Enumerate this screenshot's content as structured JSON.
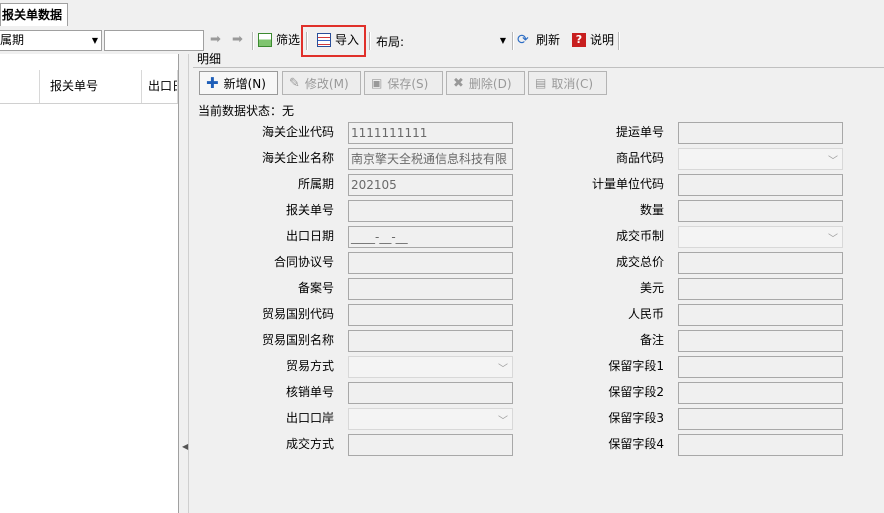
{
  "tab": {
    "title": "报关单数据"
  },
  "toolbar": {
    "period_combo": "属期",
    "search_value": "",
    "filter_label": "筛选",
    "import_label": "导入",
    "layout_label": "布局:",
    "layout_value": "",
    "refresh_label": "刷新",
    "help_label": "说明",
    "highlight_color": "#e0302a"
  },
  "grid": {
    "columns": [
      "报关单号",
      "出口日"
    ]
  },
  "detail": {
    "group_title": "明细",
    "buttons": {
      "add": "新增(N)",
      "edit": "修改(M)",
      "save": "保存(S)",
      "delete": "删除(D)",
      "cancel": "取消(C)"
    },
    "status_text": "当前数据状态：无",
    "left_fields": [
      {
        "label": "海关企业代码",
        "value": "1111111111"
      },
      {
        "label": "海关企业名称",
        "value": "南京擎天全税通信息科技有限"
      },
      {
        "label": "所属期",
        "value": "202105"
      },
      {
        "label": "报关单号",
        "value": ""
      },
      {
        "label": "出口日期",
        "value": "____-__-__"
      },
      {
        "label": "合同协议号",
        "value": ""
      },
      {
        "label": "备案号",
        "value": ""
      },
      {
        "label": "贸易国别代码",
        "value": ""
      },
      {
        "label": "贸易国别名称",
        "value": ""
      },
      {
        "label": "贸易方式",
        "value": ""
      },
      {
        "label": "核销单号",
        "value": ""
      },
      {
        "label": "出口口岸",
        "value": ""
      },
      {
        "label": "成交方式",
        "value": ""
      }
    ],
    "right_fields": [
      {
        "label": "提运单号",
        "value": ""
      },
      {
        "label": "商品代码",
        "value": ""
      },
      {
        "label": "计量单位代码",
        "value": ""
      },
      {
        "label": "数量",
        "value": ""
      },
      {
        "label": "成交币制",
        "value": ""
      },
      {
        "label": "成交总价",
        "value": ""
      },
      {
        "label": "美元",
        "value": ""
      },
      {
        "label": "人民币",
        "value": ""
      },
      {
        "label": "备注",
        "value": ""
      },
      {
        "label": "保留字段1",
        "value": ""
      },
      {
        "label": "保留字段2",
        "value": ""
      },
      {
        "label": "保留字段3",
        "value": ""
      },
      {
        "label": "保留字段4",
        "value": ""
      }
    ]
  }
}
